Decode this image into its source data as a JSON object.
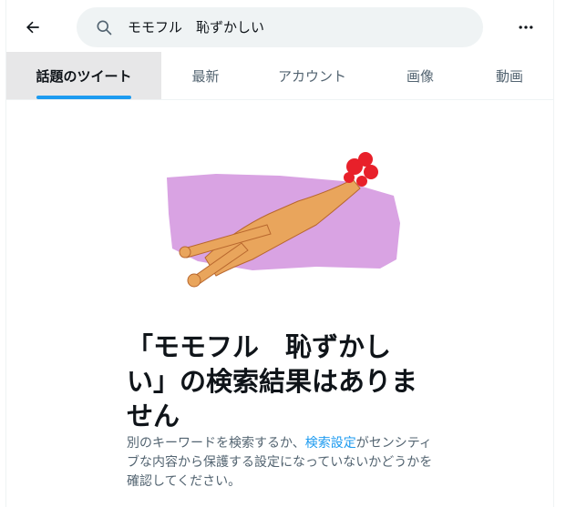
{
  "search": {
    "query": "モモフル　恥ずかしい"
  },
  "tabs": [
    {
      "label": "話題のツイート",
      "active": true
    },
    {
      "label": "最新"
    },
    {
      "label": "アカウント"
    },
    {
      "label": "画像"
    },
    {
      "label": "動画"
    }
  ],
  "empty_state": {
    "title": "「モモフル　恥ずかしい」の検索結果はありません",
    "desc_before": "別のキーワードを検索するか、",
    "desc_link": "検索設定",
    "desc_after": "がセンシティブな内容から保護する設定になっていないかどうかを確認してください。"
  },
  "icons": {
    "back": "arrow-left-icon",
    "search": "search-icon",
    "more": "more-horizontal-icon"
  },
  "colors": {
    "accent": "#1d9bf0",
    "illustration_bg": "#d9a3e3",
    "chicken_body": "#e9a55c",
    "chicken_comb": "#e8202a"
  }
}
